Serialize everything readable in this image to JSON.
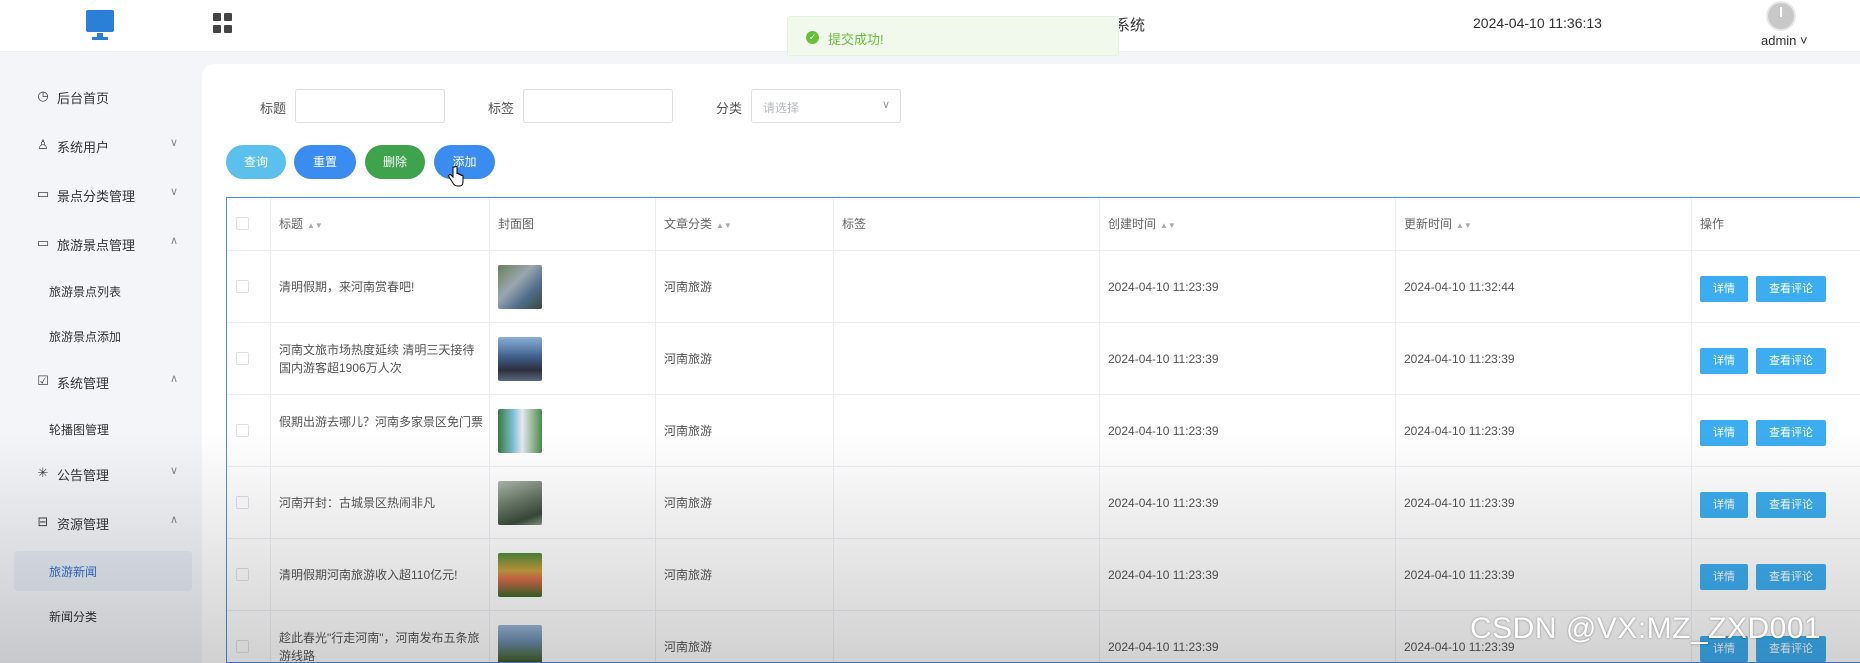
{
  "header": {
    "title_fragment": "系统",
    "datetime": "2024-04-10 11:36:13",
    "user": "admin ˅"
  },
  "toast": {
    "message": "提交成功!"
  },
  "sidebar": {
    "items": [
      {
        "label": "后台首页",
        "icon": "clock-icon",
        "arrow": ""
      },
      {
        "label": "系统用户",
        "icon": "user-icon",
        "arrow": "∨"
      },
      {
        "label": "景点分类管理",
        "icon": "card-icon",
        "arrow": "∨"
      },
      {
        "label": "旅游景点管理",
        "icon": "card-icon",
        "arrow": "∧"
      },
      {
        "label": "系统管理",
        "icon": "check-card-icon",
        "arrow": "∧"
      },
      {
        "label": "公告管理",
        "icon": "spinner-icon",
        "arrow": "∨"
      },
      {
        "label": "资源管理",
        "icon": "box-icon",
        "arrow": "∧"
      }
    ],
    "sub_items": {
      "scenic_list": "旅游景点列表",
      "scenic_add": "旅游景点添加",
      "carousel": "轮播图管理",
      "travel_news": "旅游新闻",
      "news_category": "新闻分类"
    }
  },
  "filters": {
    "title_label": "标题",
    "tag_label": "标签",
    "category_label": "分类",
    "category_placeholder": "请选择"
  },
  "buttons": {
    "query": "查询",
    "reset": "重置",
    "delete": "删除",
    "add": "添加"
  },
  "colors": {
    "query": "#5bc0eb",
    "reset": "#3b8cf0",
    "delete": "#3fa34d",
    "add": "#3b8cf0",
    "op_button": "#3cadf0"
  },
  "table": {
    "columns": [
      "标题",
      "封面图",
      "文章分类",
      "标签",
      "创建时间",
      "更新时间",
      "操作"
    ],
    "rows": [
      {
        "title": "清明假期，来河南赏春吧!",
        "category": "河南旅游",
        "tag": "",
        "created": "2024-04-10 11:23:39",
        "updated": "2024-04-10 11:32:44"
      },
      {
        "title": "河南文旅市场热度延续 清明三天接待国内游客超1906万人次",
        "category": "河南旅游",
        "tag": "",
        "created": "2024-04-10 11:23:39",
        "updated": "2024-04-10 11:23:39"
      },
      {
        "title": "假期出游去哪儿？河南多家景区免门票",
        "category": "河南旅游",
        "tag": "",
        "created": "2024-04-10 11:23:39",
        "updated": "2024-04-10 11:23:39"
      },
      {
        "title": "河南开封：古城景区热闹非凡",
        "category": "河南旅游",
        "tag": "",
        "created": "2024-04-10 11:23:39",
        "updated": "2024-04-10 11:23:39"
      },
      {
        "title": "清明假期河南旅游收入超110亿元!",
        "category": "河南旅游",
        "tag": "",
        "created": "2024-04-10 11:23:39",
        "updated": "2024-04-10 11:23:39"
      },
      {
        "title": "趁此春光\"行走河南\"，河南发布五条旅游线路",
        "category": "河南旅游",
        "tag": "",
        "created": "2024-04-10 11:23:39",
        "updated": "2024-04-10 11:23:39"
      }
    ],
    "detail_label": "详情",
    "comments_label": "查看评论"
  },
  "watermark": "CSDN @VX:MZ_ZXD001"
}
